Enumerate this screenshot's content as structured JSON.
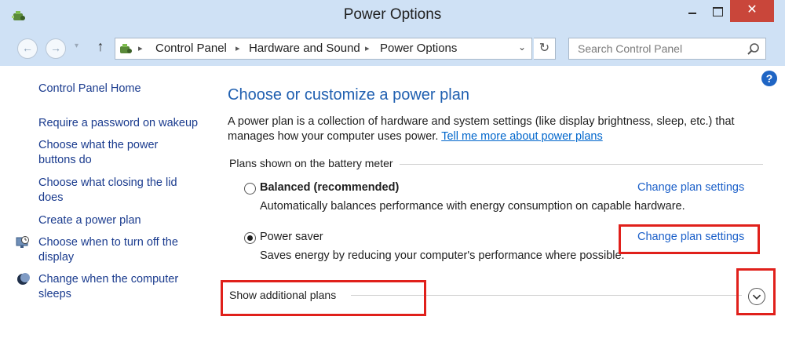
{
  "window": {
    "title": "Power Options",
    "close_glyph": "✕"
  },
  "nav": {
    "back_glyph": "←",
    "forward_glyph": "→",
    "recent_glyph": "▾",
    "up_glyph": "↑",
    "breadcrumbs": [
      "Control Panel",
      "Hardware and Sound",
      "Power Options"
    ],
    "separator_glyph": "▸",
    "dropdown_glyph": "⌄",
    "refresh_glyph": "↻"
  },
  "search": {
    "placeholder": "Search Control Panel"
  },
  "help_glyph": "?",
  "sidebar": {
    "home": "Control Panel Home",
    "links": [
      {
        "label": "Require a password on wakeup",
        "icon": "none"
      },
      {
        "label": "Choose what the power buttons do",
        "icon": "none"
      },
      {
        "label": "Choose what closing the lid does",
        "icon": "none"
      },
      {
        "label": "Create a power plan",
        "icon": "none"
      },
      {
        "label": "Choose when to turn off the display",
        "icon": "display-timer-icon"
      },
      {
        "label": "Change when the computer sleeps",
        "icon": "sleep-moon-icon"
      }
    ]
  },
  "main": {
    "heading": "Choose or customize a power plan",
    "description": "A power plan is a collection of hardware and system settings (like display brightness, sleep, etc.) that manages how your computer uses power.",
    "learn_more": "Tell me more about power plans",
    "group_title": "Plans shown on the battery meter",
    "plans": [
      {
        "name": "Balanced (recommended)",
        "description": "Automatically balances performance with energy consumption on capable hardware.",
        "link": "Change plan settings",
        "selected": false
      },
      {
        "name": "Power saver",
        "description": "Saves energy by reducing your computer's performance where possible.",
        "link": "Change plan settings",
        "selected": true
      }
    ],
    "additional_plans": "Show additional plans"
  },
  "colors": {
    "frame": "#cfe1f5",
    "close_button": "#c9463a",
    "heading": "#1f5fb0",
    "link": "#1a5fc9",
    "highlight_box": "#e0201b"
  }
}
